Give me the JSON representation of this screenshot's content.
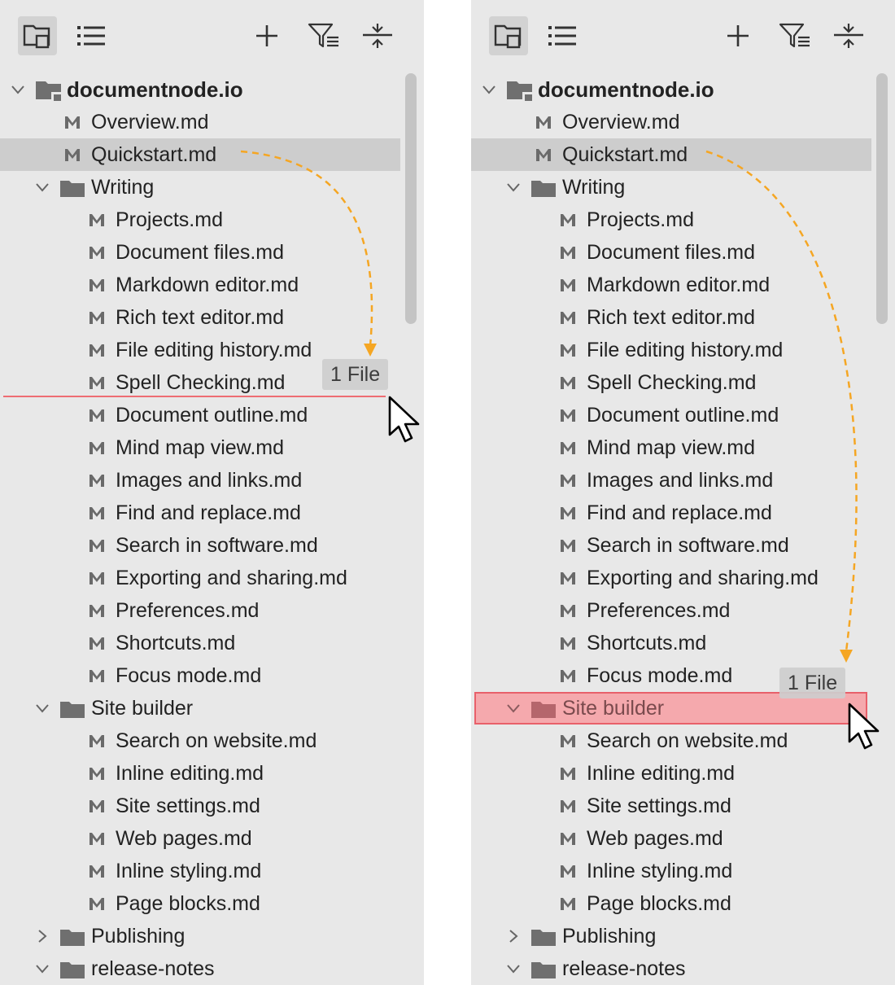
{
  "colors": {
    "panel_bg": "#e8e8e8",
    "selected_row": "#cdcdcd",
    "drop_target": "#f5a9ad",
    "drop_line": "#ee6d73",
    "drag_path": "#f5a623"
  },
  "toolbar": {
    "icons": [
      "folder-tree-view-icon",
      "list-view-icon",
      "add-icon",
      "filter-icon",
      "collapse-all-icon"
    ]
  },
  "tree": {
    "root": "documentnode.io",
    "top_files": [
      "Overview.md",
      "Quickstart.md"
    ],
    "writing": {
      "label": "Writing",
      "files": [
        "Projects.md",
        "Document files.md",
        "Markdown editor.md",
        "Rich text editor.md",
        "File editing history.md",
        "Spell Checking.md",
        "Document outline.md",
        "Mind map view.md",
        "Images and links.md",
        "Find and replace.md",
        "Search in software.md",
        "Exporting and sharing.md",
        "Preferences.md",
        "Shortcuts.md",
        "Focus mode.md"
      ]
    },
    "site_builder": {
      "label": "Site builder",
      "files": [
        "Search on website.md",
        "Inline editing.md",
        "Site settings.md",
        "Web pages.md",
        "Inline styling.md",
        "Page blocks.md"
      ]
    },
    "publishing": "Publishing",
    "release_notes": "release-notes"
  },
  "drag": {
    "badge_text": "1 File",
    "item": "Quickstart.md"
  },
  "panels": [
    {
      "id": "left",
      "drop": "line-between-spell-checking-and-document-outline"
    },
    {
      "id": "right",
      "drop": "onto-site-builder-folder"
    }
  ]
}
